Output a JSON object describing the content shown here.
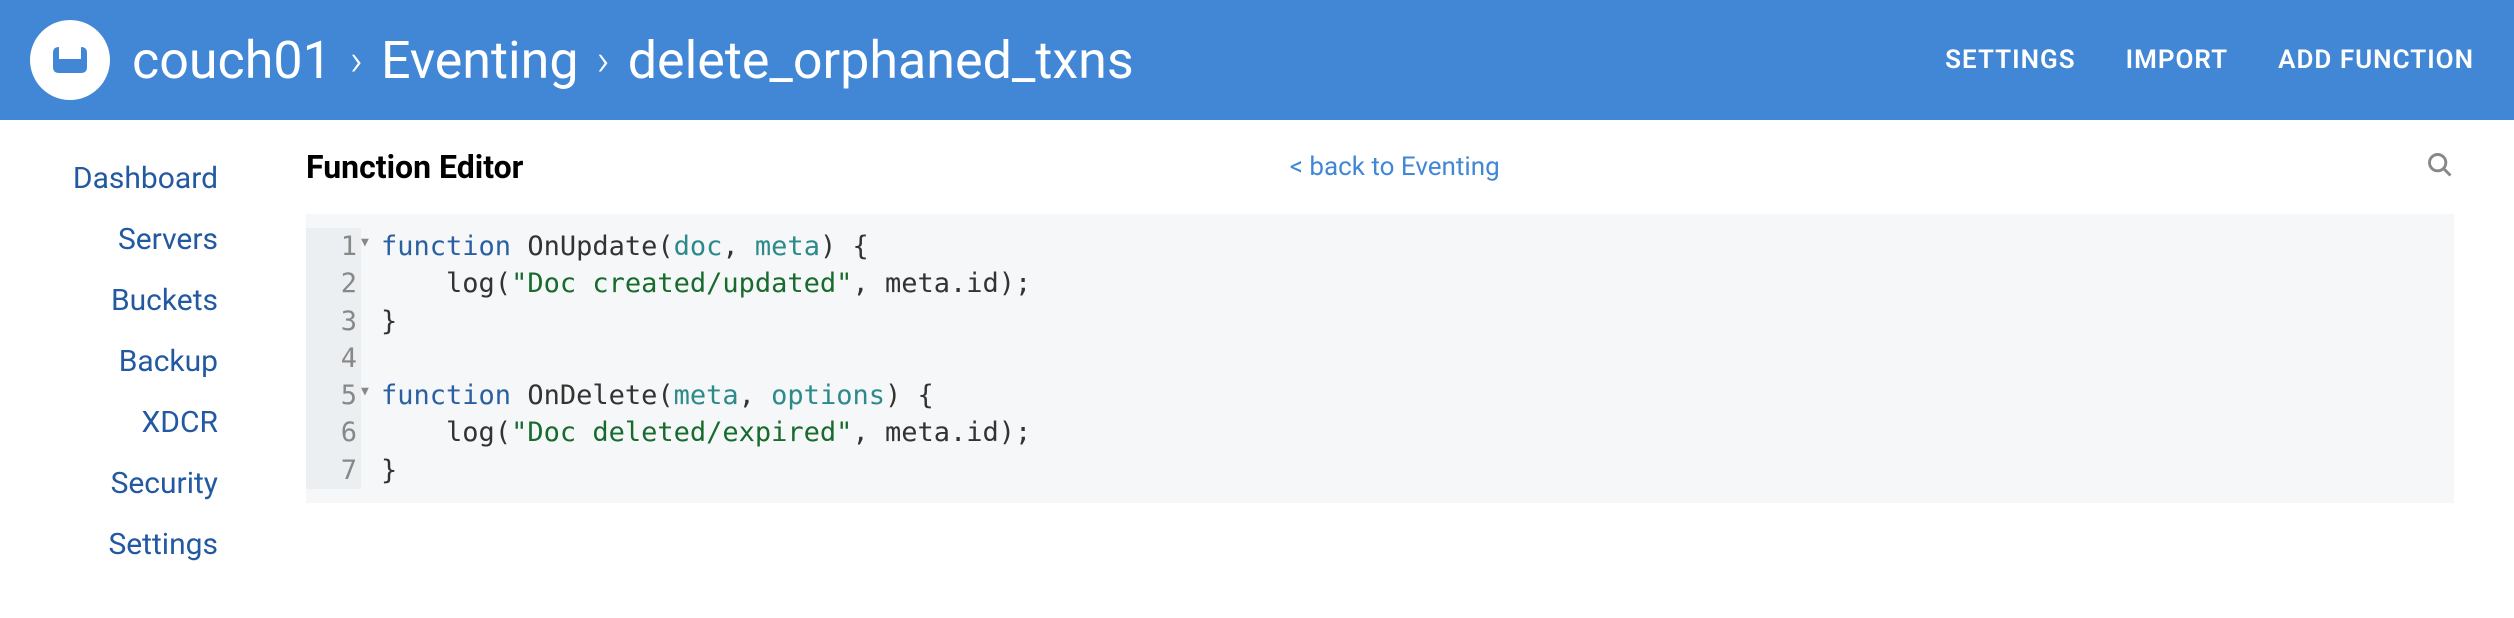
{
  "breadcrumb": {
    "cluster": "couch01",
    "section": "Eventing",
    "fn_name": "delete_orphaned_txns"
  },
  "header_actions": {
    "settings": "SETTINGS",
    "import": "IMPORT",
    "add_function": "ADD FUNCTION"
  },
  "sidebar": {
    "items": [
      {
        "label": "Dashboard"
      },
      {
        "label": "Servers"
      },
      {
        "label": "Buckets"
      },
      {
        "label": "Backup"
      },
      {
        "label": "XDCR"
      },
      {
        "label": "Security"
      },
      {
        "label": "Settings"
      }
    ]
  },
  "page": {
    "title": "Function Editor",
    "back_link": "< back to Eventing"
  },
  "code": {
    "lines": [
      {
        "num": "1",
        "foldable": true
      },
      {
        "num": "2",
        "foldable": false
      },
      {
        "num": "3",
        "foldable": false
      },
      {
        "num": "4",
        "foldable": false
      },
      {
        "num": "5",
        "foldable": true
      },
      {
        "num": "6",
        "foldable": false
      },
      {
        "num": "7",
        "foldable": false
      }
    ],
    "tokens": {
      "kw_function": "function",
      "fn_onupdate": "OnUpdate",
      "fn_ondelete": "OnDelete",
      "fn_log": "log",
      "param_doc": "doc",
      "param_meta": "meta",
      "param_options": "options",
      "str_created": "\"Doc created/updated\"",
      "str_deleted": "\"Doc deleted/expired\"",
      "prop_id": "id",
      "open_paren": "(",
      "close_paren": ")",
      "open_brace": "{",
      "close_brace": "}",
      "comma_sp": ", ",
      "dot": ".",
      "semicolon": ";",
      "space": " ",
      "indent": "    "
    }
  }
}
